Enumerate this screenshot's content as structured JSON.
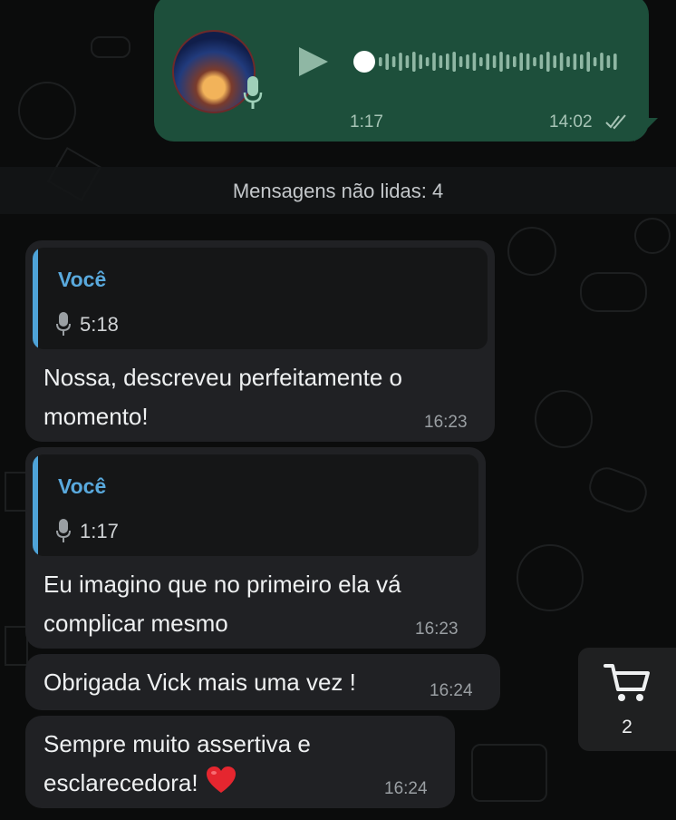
{
  "outgoing_voice": {
    "duration": "1:17",
    "time": "14:02",
    "status_icon": "double-check-icon"
  },
  "unread_banner": "Mensagens não lidas: 4",
  "messages": [
    {
      "quote_author": "Você",
      "quote_duration": "5:18",
      "line1": "Nossa, descreveu perfeitamente o",
      "line2": "momento!",
      "time": "16:23"
    },
    {
      "quote_author": "Você",
      "quote_duration": "1:17",
      "line1": "Eu imagino que no primeiro ela vá",
      "line2": "complicar mesmo",
      "time": "16:23"
    },
    {
      "line1": "Obrigada Vick mais uma vez !",
      "time": "16:24"
    },
    {
      "line1": "Sempre muito assertiva e",
      "line2": "esclarecedora!",
      "emoji": "red-heart-icon",
      "time": "16:24"
    }
  ],
  "cart": {
    "count": "2",
    "icon": "cart-icon"
  },
  "colors": {
    "outgoing_bubble": "#1d4f3b",
    "incoming_bubble": "#202124",
    "quote_accent": "#59a9dd",
    "background": "#0b0c0c"
  }
}
